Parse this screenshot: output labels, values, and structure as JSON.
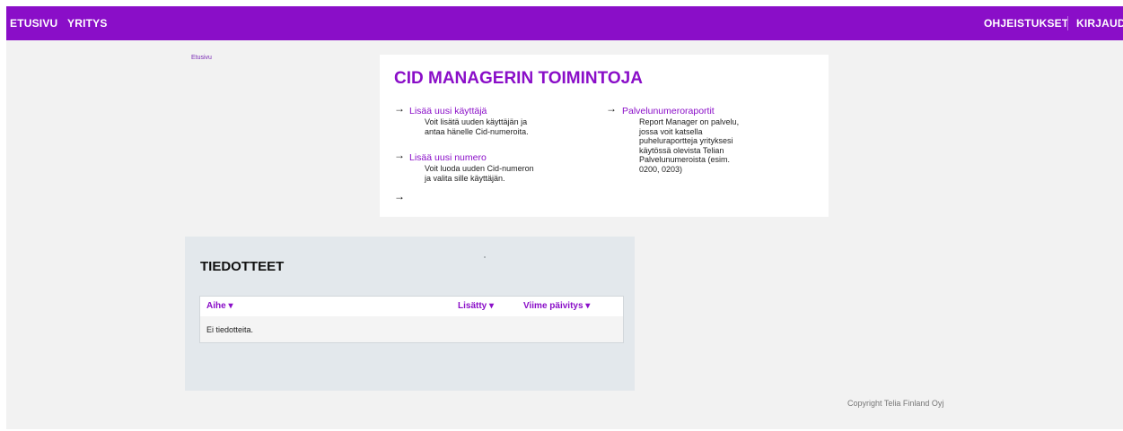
{
  "nav": {
    "left": [
      "ETUSIVU",
      "YRITYS"
    ],
    "right": [
      "OHJEISTUKSET",
      "KIRJAUD"
    ]
  },
  "breadcrumb": "Etusivu",
  "cid_panel": {
    "title": "CID MANAGERIN TOIMINTOJA",
    "arrow_glyph": "→",
    "features": [
      {
        "label": "Lisää uusi käyttäjä",
        "desc": [
          "Voit lisätä uuden käyttäjän ja",
          "antaa hänelle Cid-numeroita."
        ]
      },
      {
        "label": "Lisää uusi numero",
        "desc": [
          "Voit luoda uuden Cid-numeron",
          "ja valita sille käyttäjän."
        ]
      },
      {
        "label": "Palvelunumeroraportit",
        "desc": [
          "Report Manager on palvelu,",
          "jossa voit katsella",
          "puheluraportteja yrityksesi",
          "käytössä olevista Telian",
          "Palvelunumeroista (esim.",
          "0200, 0203)"
        ]
      }
    ]
  },
  "news": {
    "title": "TIEDOTTEET",
    "columns": [
      "Aihe ▾",
      "Lisätty ▾",
      "Viime päivitys ▾"
    ],
    "empty_text": "Ei tiedotteita."
  },
  "footer": {
    "copyright": "Copyright Telia Finland Oyj"
  },
  "colors": {
    "brand": "#8a0ec8",
    "background": "#f2f2f2",
    "news_panel": "#e3e8ec"
  }
}
